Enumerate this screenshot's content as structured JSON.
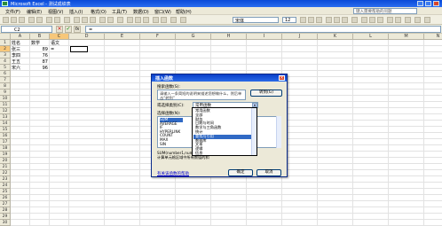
{
  "window": {
    "title": "Microsoft Excel - 测试成绩表"
  },
  "menu": {
    "items": [
      "文件(F)",
      "编辑(E)",
      "视图(V)",
      "插入(I)",
      "格式(O)",
      "工具(T)",
      "数据(D)",
      "窗口(W)",
      "帮助(H)"
    ],
    "ask_placeholder": "键入需要帮助的问题"
  },
  "toolbar": {
    "font_name": "宋体",
    "font_size": "12"
  },
  "formula_bar": {
    "name_box": "C2",
    "cancel_icon": "×",
    "enter_icon": "✓",
    "fx_label": "fx",
    "content": "="
  },
  "sheet": {
    "columns": [
      "A",
      "B",
      "C",
      "D",
      "E",
      "F",
      "G",
      "H",
      "I",
      "J",
      "K",
      "L",
      "M",
      "N"
    ],
    "rows": [
      "1",
      "2",
      "3",
      "4",
      "5",
      "6",
      "7",
      "8",
      "9",
      "10",
      "11",
      "12",
      "13",
      "14",
      "15",
      "16",
      "17",
      "18",
      "19",
      "20",
      "21",
      "22",
      "23",
      "24",
      "25",
      "26",
      "27",
      "28",
      "29",
      "30"
    ],
    "cells": {
      "A1": "姓名",
      "B1": "数学",
      "C1": "语文",
      "A2": "张三",
      "B2": "89",
      "C2": "=",
      "A3": "李四",
      "B3": "76",
      "A4": "王五",
      "B4": "87",
      "A5": "宋六",
      "B5": "96"
    }
  },
  "dialog": {
    "title": "插入函数",
    "search_label": "搜索函数(S):",
    "search_text": "请输入一条简短的说明来描述您想做什么，然后单击“转到”",
    "go_button": "转到(G)",
    "category_label": "或选择类别(C):",
    "category_value": "常用函数",
    "function_label": "选择函数(N):",
    "functions": [
      "SUM",
      "AVERAGE",
      "IF",
      "HYPERLINK",
      "COUNT",
      "MAX",
      "SIN"
    ],
    "selected_function": "SUM",
    "description": "SUM(number1,number2,...)\n计算单元格区域中所有数值的和",
    "help_link": "有关该函数的帮助",
    "ok_button": "确定",
    "cancel_button": "取消",
    "close_icon": "×"
  },
  "category_dropdown": {
    "items": [
      "常用函数",
      "全部",
      "财务",
      "日期与时间",
      "数学与三角函数",
      "统计",
      "查找与引用",
      "数据库",
      "文本",
      "逻辑",
      "信息"
    ],
    "highlighted": "查找与引用"
  }
}
